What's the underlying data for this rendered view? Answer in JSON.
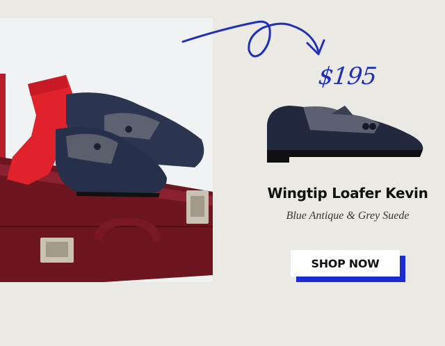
{
  "product": {
    "price": "$195",
    "name": "Wingtip Loafer Kevin",
    "variant": "Blue Antique & Grey Suede"
  },
  "cta": {
    "label": "SHOP NOW"
  },
  "colors": {
    "background": "#ebe9e4",
    "accent": "#1a2bd6",
    "price": "#1e2fb8"
  },
  "icons": {
    "arrow": "hand-drawn-arrow-icon"
  }
}
